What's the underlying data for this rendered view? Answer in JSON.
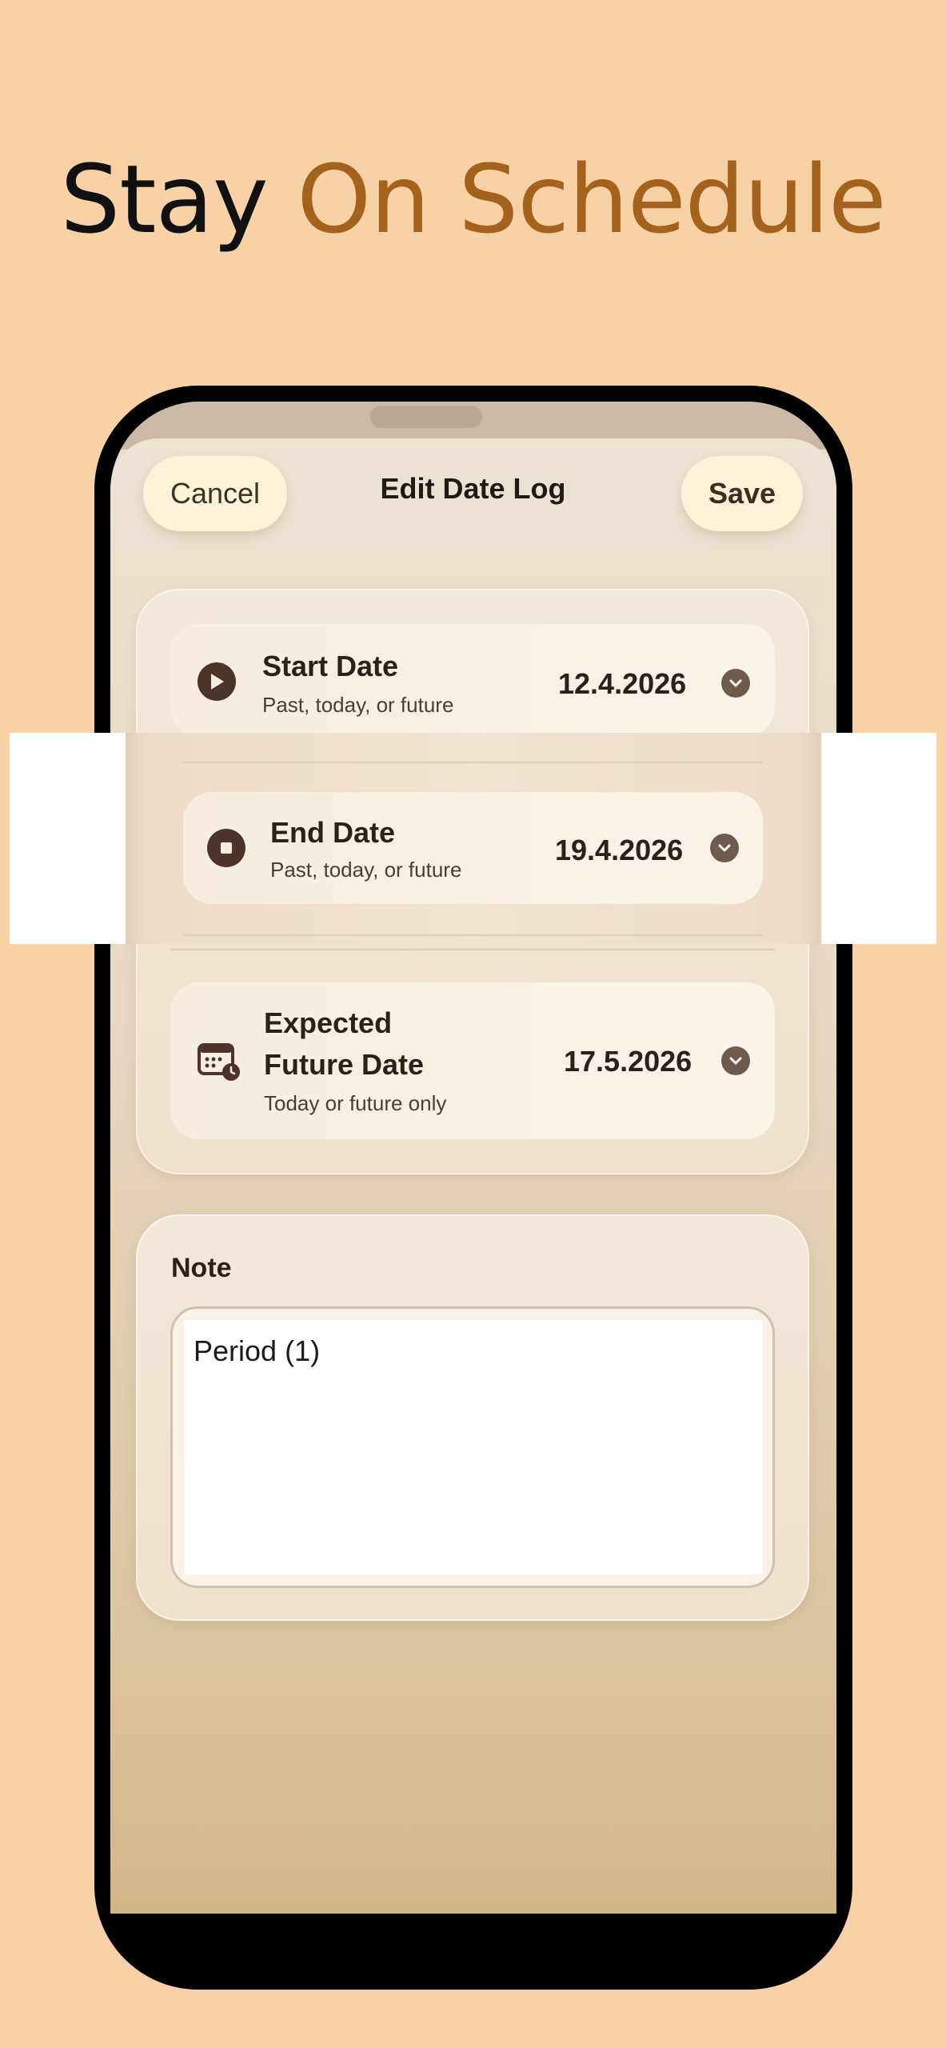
{
  "headline": {
    "part1": "Stay",
    "part2": "On Schedule"
  },
  "nav": {
    "cancel_label": "Cancel",
    "title": "Edit Date Log",
    "save_label": "Save"
  },
  "dates": {
    "start": {
      "title": "Start Date",
      "subtitle": "Past, today, or future",
      "value": "12.4.2026",
      "icon": "play-icon"
    },
    "end": {
      "title": "End Date",
      "subtitle": "Past, today, or future",
      "value": "19.4.2026",
      "icon": "stop-icon"
    },
    "expected": {
      "title_line1": "Expected",
      "title_line2": "Future Date",
      "subtitle": "Today or future only",
      "value": "17.5.2026",
      "icon": "calendar-clock-icon"
    }
  },
  "note": {
    "label": "Note",
    "value": "Period (1)"
  },
  "colors": {
    "background": "#F8D1A6",
    "accent": "#A5621C",
    "icon_dark": "#4E3426",
    "chevron": "#6E5B4C"
  }
}
